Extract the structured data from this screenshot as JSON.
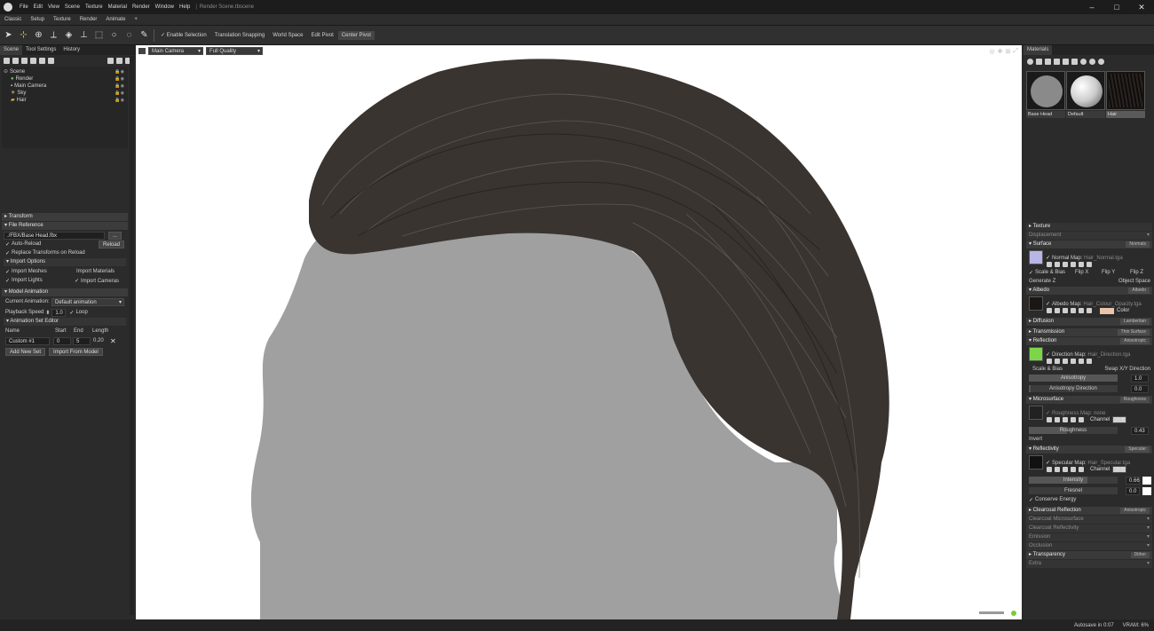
{
  "app": {
    "menu": [
      "File",
      "Edit",
      "View",
      "Scene",
      "Texture",
      "Material",
      "Render",
      "Window",
      "Help"
    ],
    "doc_title": "Render Scene.tbscene",
    "window_controls": [
      "–",
      "□",
      "✕"
    ]
  },
  "modes": [
    "Classic",
    "Setup",
    "Texture",
    "Render",
    "Animate",
    "+"
  ],
  "toolbar": {
    "enable_selection": "Enable Selection",
    "translation_snapping": "Translation Snapping",
    "world_space": "World Space",
    "edit_pivot": "Edit Pivot",
    "center_pivot": "Center Pivot"
  },
  "left_panel": {
    "tabs": [
      "Scene",
      "Tool Settings",
      "History"
    ],
    "tree": [
      {
        "label": "Scene",
        "depth": 0
      },
      {
        "label": "Render",
        "depth": 1
      },
      {
        "label": "Main Camera",
        "depth": 1
      },
      {
        "label": "Sky",
        "depth": 1
      },
      {
        "label": "Hair",
        "depth": 1
      }
    ],
    "transform": "Transform",
    "file_reference": "File Reference",
    "file_path": "./FBX/Base Head.fbx",
    "browse": "...",
    "auto_reload": "Auto-Reload",
    "reload": "Reload",
    "replace_transforms": "Replace Transforms on Reload",
    "import_options": "Import Options",
    "import_meshes": "Import Meshes",
    "import_materials": "Import Materials",
    "import_lights": "Import Lights",
    "import_cameras": "Import Cameras",
    "model_animation": "Model Animation",
    "current_animation_label": "Current Animation:",
    "current_animation_value": "Default animation",
    "playback_speed_label": "Playback Speed",
    "playback_speed_value": "1.0",
    "loop": "Loop",
    "animation_set_editor": "Animation Set Editor",
    "anim_cols": [
      "Name",
      "Start",
      "End",
      "Length"
    ],
    "anim_row": {
      "name": "Custom #1",
      "start": "0",
      "end": "5",
      "length": "0.20"
    },
    "add_new_set": "Add New Set",
    "import_from_model": "Import From Model"
  },
  "viewport": {
    "camera": "Main Camera",
    "quality": "Full Quality"
  },
  "right_panel": {
    "tab": "Materials",
    "materials": [
      {
        "label": "Base Head"
      },
      {
        "label": "Default"
      },
      {
        "label": "Hair"
      }
    ],
    "texture": "Texture",
    "displacement": "Displacement",
    "surface": "Surface",
    "surface_mode": "Normals",
    "normal_map_label": "Normal Map:",
    "normal_map_file": "Hair_Normal.tga",
    "scale_bias": "Scale & Bias",
    "flip_x": "Flip X",
    "flip_y": "Flip Y",
    "flip_z": "Flip Z",
    "generate_z": "Generate Z",
    "object_space": "Object Space",
    "albedo": "Albedo",
    "albedo_mode": "Albedo",
    "albedo_map_label": "Albedo Map:",
    "albedo_map_file": "Hair_Colour_Opacity.tga",
    "color": "Color",
    "diffusion": "Diffusion",
    "diffusion_mode": "Lambertian",
    "transmission": "Transmission",
    "transmission_mode": "Thin Surface",
    "reflection": "Reflection",
    "reflection_mode": "Anisotropic",
    "direction_map_label": "Direction Map:",
    "direction_map_file": "Hair_Direction.tga",
    "swap_xy": "Swap X/Y Direction",
    "anisotropy_label": "Anisotropy",
    "anisotropy_value": "1.0",
    "aniso_dir_label": "Anisotropy Direction",
    "aniso_dir_value": "0.0",
    "microsurface": "Microsurface",
    "microsurface_mode": "Roughness",
    "roughness_map_label": "Roughness Map:",
    "roughness_map_file": "none",
    "channel_label": "Channel",
    "channel_value": "R",
    "roughness_label": "Roughness",
    "roughness_value": "0.43",
    "invert": "Invert",
    "reflectivity": "Reflectivity",
    "reflectivity_mode": "Specular",
    "specular_map_label": "Specular Map:",
    "specular_map_file": "Hair_Specular.tga",
    "intensity_label": "Intensity",
    "intensity_value": "0.66",
    "fresnel_label": "Fresnel",
    "fresnel_value": "0.0",
    "conserve_energy": "Conserve Energy",
    "clearcoat_reflection": "Clearcoat Reflection",
    "clearcoat_mode": "Anisotropic",
    "clearcoat_microsurface": "Clearcoat Microsurface",
    "clearcoat_reflectivity": "Clearcoat Reflectivity",
    "emission": "Emission",
    "occlusion": "Occlusion",
    "transparency": "Transparency",
    "transparency_mode": "Dither",
    "extra": "Extra"
  },
  "status": {
    "autosave": "Autosave in 0:07",
    "vram": "VRAM: 6%"
  },
  "colors": {
    "ui_bg": "#2b2b2b",
    "viewport_bg": "#ffffff",
    "head": "#a0a0a0",
    "hair": "#3a3430",
    "normal_swatch": "#b8b6e6",
    "direction_swatch": "#7dd64a",
    "albedo_color": "#e9c4aa"
  }
}
